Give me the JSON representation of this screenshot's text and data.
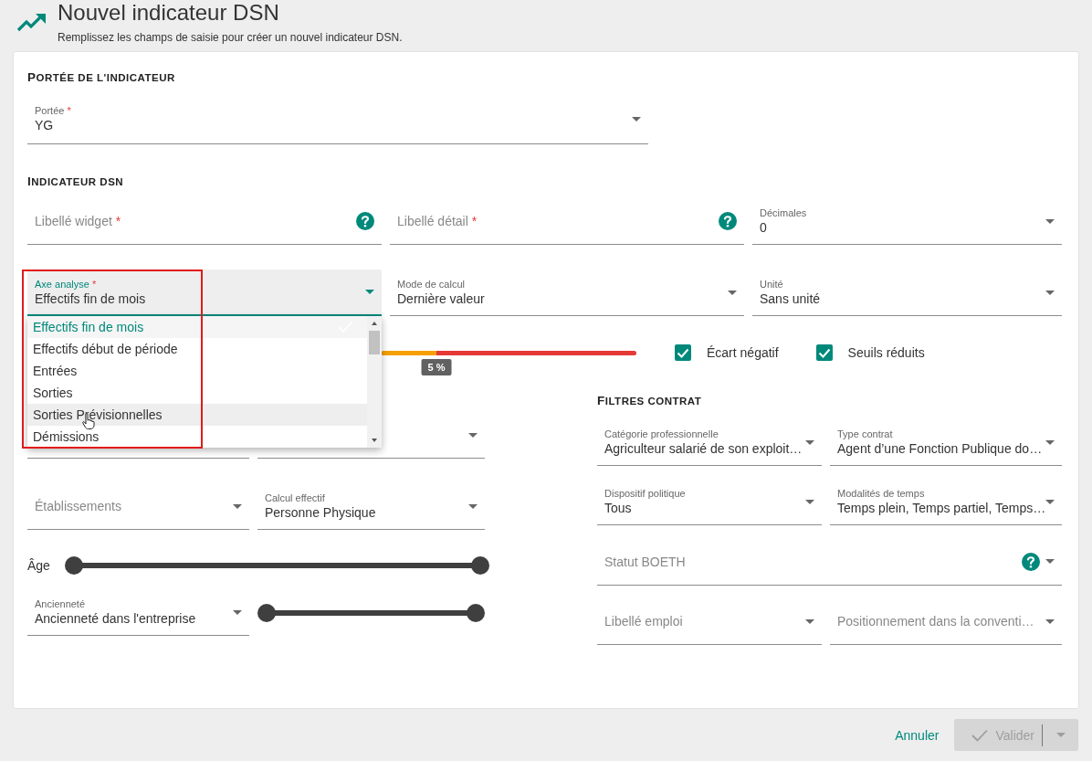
{
  "header": {
    "title": "Nouvel indicateur DSN",
    "subtitle": "Remplissez les champs de saisie pour créer un nouvel indicateur DSN."
  },
  "scope_section": {
    "heading": "PORTÉE DE L'INDICATEUR",
    "field": {
      "kind": "select",
      "label": "Portée",
      "required_mark": "*",
      "value": "YG"
    }
  },
  "indicator_section": {
    "heading": "INDICATEUR DSN",
    "row_1": [
      {
        "kind": "text",
        "label": "Libellé widget",
        "required_mark": "*",
        "help": true
      },
      {
        "kind": "text",
        "label": "Libellé détail",
        "required_mark": "*",
        "help": true
      },
      {
        "kind": "select",
        "label": "Décimales",
        "value": "0"
      }
    ],
    "row_2": [
      {
        "kind": "select",
        "label": "Axe analyse",
        "required_mark": "*",
        "value": "Effectifs fin de mois",
        "focused": true,
        "highlighted": true,
        "options": [
          {
            "label": "Effectifs fin de mois",
            "selected": true,
            "hovered": false
          },
          {
            "label": "Effectifs début de période",
            "selected": false,
            "hovered": false
          },
          {
            "label": "Entrées",
            "selected": false,
            "hovered": false
          },
          {
            "label": "Sorties",
            "selected": false,
            "hovered": false
          },
          {
            "label": "Sorties Prévisionnelles",
            "selected": false,
            "hovered": true
          },
          {
            "label": "Démissions",
            "selected": false,
            "hovered": false
          }
        ]
      },
      {
        "kind": "select",
        "label": "Mode de calcul",
        "value": "Dernière valeur"
      },
      {
        "kind": "select",
        "label": "Unité",
        "value": "Sans unité"
      }
    ],
    "threshold_bar": {
      "level": 0.215,
      "label": "5 %"
    },
    "checkboxes": [
      {
        "label": "Écart négatif",
        "checked": true
      },
      {
        "label": "Seuils réduits",
        "checked": true
      }
    ]
  },
  "left_filters": {
    "rows": [
      [
        {
          "kind": "select"
        },
        {
          "kind": "select"
        }
      ],
      [
        {
          "kind": "select",
          "label": "Établissements"
        },
        {
          "kind": "select",
          "label": "Calcul effectif",
          "value": "Personne Physique"
        }
      ]
    ],
    "age_slider": {
      "label": "Âge",
      "thumbs": [
        {
          "level": 0
        },
        {
          "level": 1
        }
      ]
    },
    "seniority": {
      "field": {
        "kind": "select",
        "label": "Ancienneté",
        "value": "Ancienneté dans l'entreprise"
      },
      "slider": {
        "thumbs": [
          {
            "level": 0
          },
          {
            "level": 1
          }
        ]
      }
    }
  },
  "contract_filters": {
    "heading": "FILTRES CONTRAT",
    "rows": [
      [
        {
          "kind": "select",
          "label": "Catégorie professionnelle",
          "value": "Agriculteur salarié de son exploit…"
        },
        {
          "kind": "select",
          "label": "Type contrat",
          "value": "Agent d’une Fonction Publique do…"
        }
      ],
      [
        {
          "kind": "select",
          "label": "Dispositif politique",
          "value": "Tous"
        },
        {
          "kind": "select",
          "label": "Modalités de temps",
          "value": "Temps plein, Temps partiel, Temps…"
        }
      ],
      [
        {
          "kind": "select",
          "label": "Statut BOETH",
          "help": true
        }
      ],
      [
        {
          "kind": "select",
          "label": "Libellé emploi"
        },
        {
          "kind": "select",
          "label": "Positionnement dans la conventi…"
        }
      ]
    ]
  },
  "footer": {
    "cancel": "Annuler",
    "submit": {
      "label": "Valider",
      "disabled": true
    }
  }
}
